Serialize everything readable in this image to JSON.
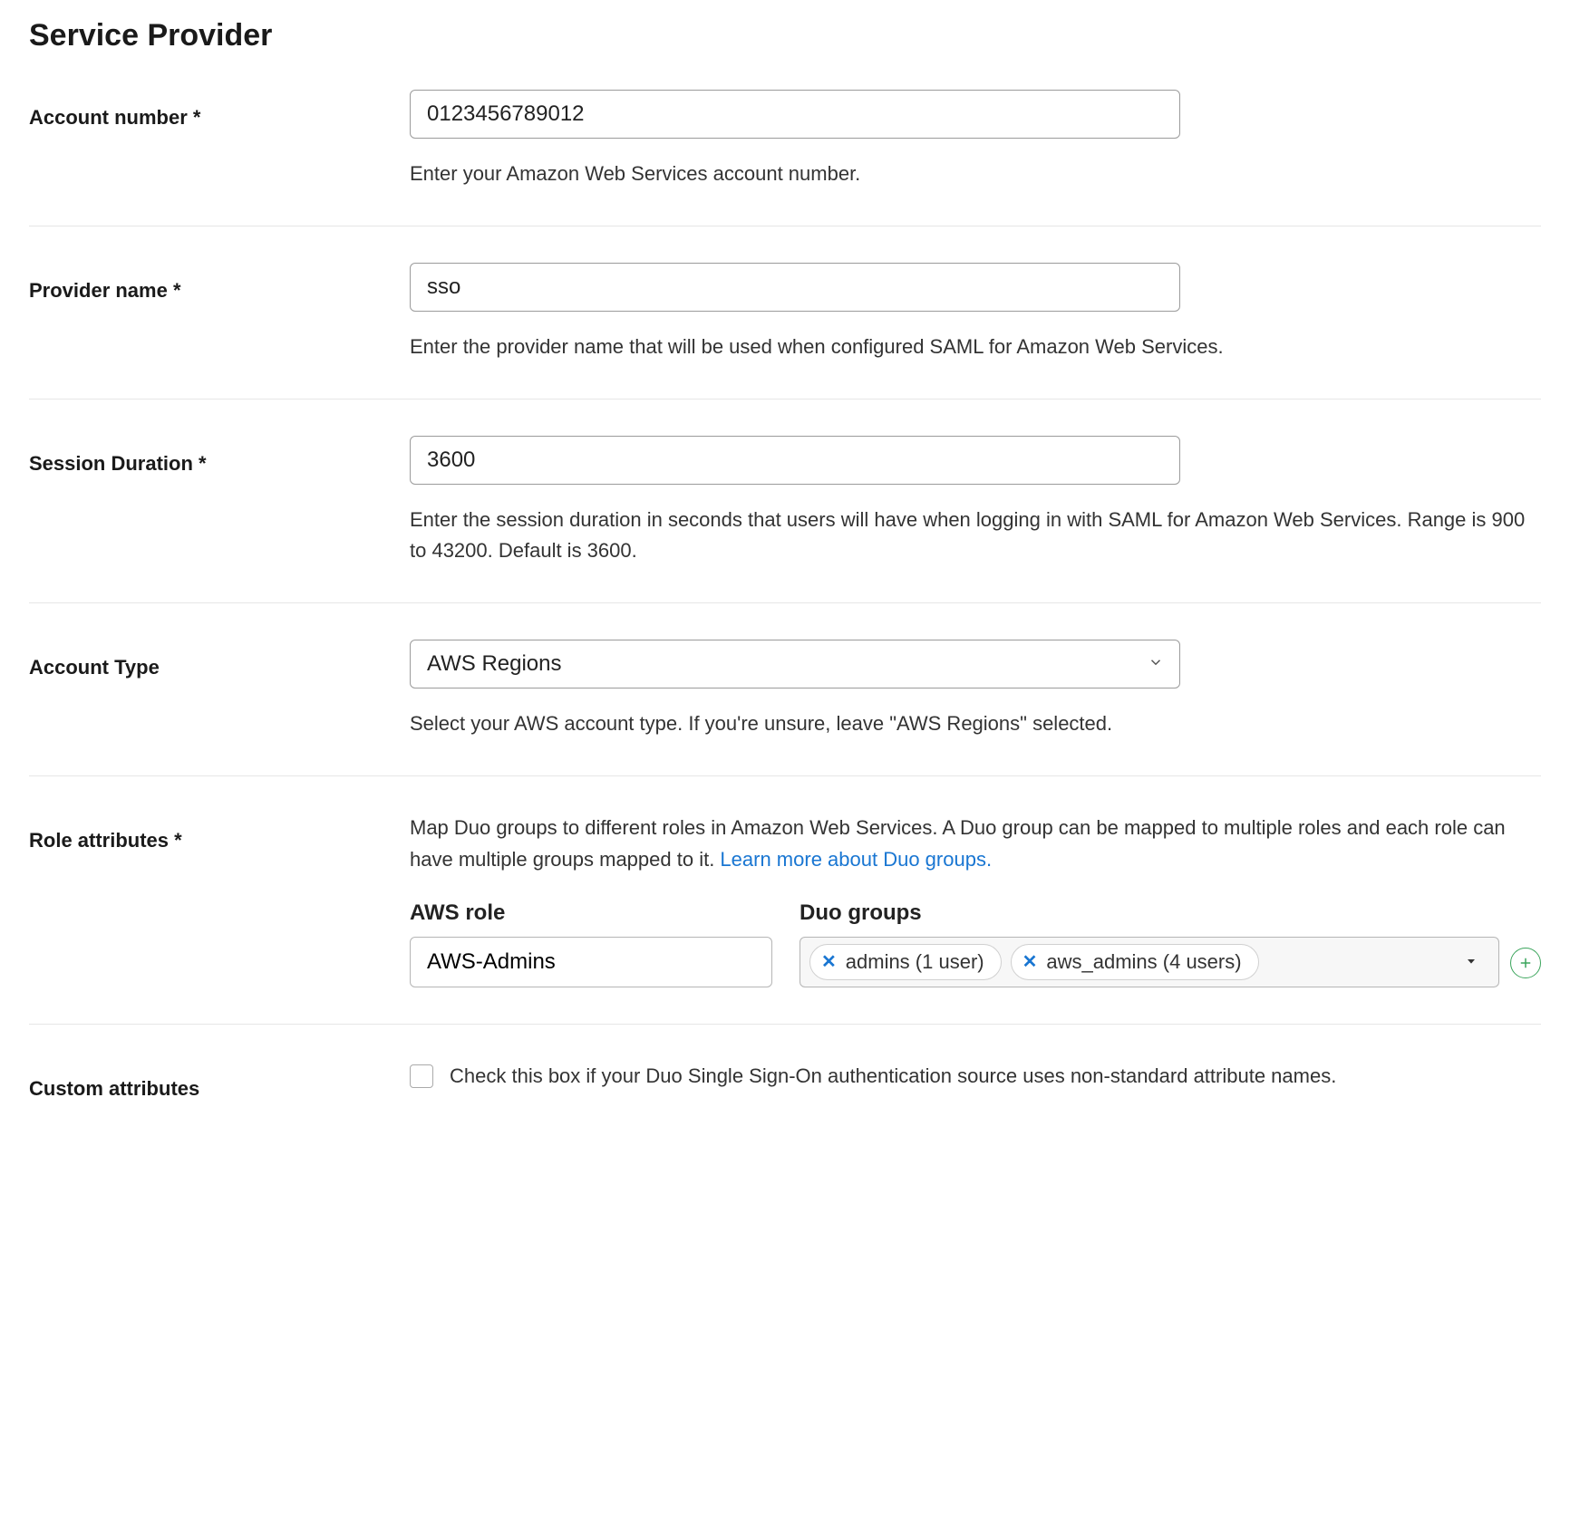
{
  "section_title": "Service Provider",
  "fields": {
    "account_number": {
      "label": "Account number *",
      "value": "0123456789012",
      "help": "Enter your Amazon Web Services account number."
    },
    "provider_name": {
      "label": "Provider name *",
      "value": "sso",
      "help": "Enter the provider name that will be used when configured SAML for Amazon Web Services."
    },
    "session_duration": {
      "label": "Session Duration *",
      "value": "3600",
      "help": "Enter the session duration in seconds that users will have when logging in with SAML for Amazon Web Services. Range is 900 to 43200. Default is 3600."
    },
    "account_type": {
      "label": "Account Type",
      "value": "AWS Regions",
      "help": "Select your AWS account type. If you're unsure, leave \"AWS Regions\" selected."
    },
    "role_attributes": {
      "label": "Role attributes *",
      "desc_pre": "Map Duo groups to different roles in Amazon Web Services. A Duo group can be mapped to multiple roles and each role can have multiple groups mapped to it. ",
      "link_text": "Learn more about Duo groups.",
      "aws_role_heading": "AWS role",
      "duo_groups_heading": "Duo groups",
      "aws_role_value": "AWS-Admins",
      "tags": [
        {
          "label": "admins (1 user)"
        },
        {
          "label": "aws_admins (4 users)"
        }
      ]
    },
    "custom_attributes": {
      "label": "Custom attributes",
      "checkbox_label": "Check this box if your Duo Single Sign-On authentication source uses non-standard attribute names.",
      "checked": false
    }
  }
}
